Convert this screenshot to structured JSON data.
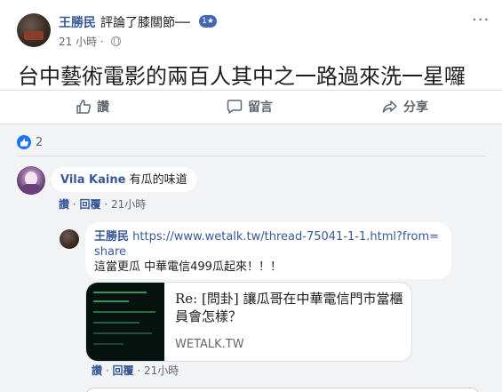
{
  "post": {
    "author": "王勝民",
    "action": "評論了膝關節──",
    "share_badge": "1★",
    "time": "21 小時",
    "separator": "·",
    "text": "台中藝術電影的兩百人其中之一路過來洗一星囉",
    "more": "···"
  },
  "actions": {
    "like": "讚",
    "comment": "留言",
    "share": "分享"
  },
  "reactions": {
    "count": "2"
  },
  "comments": [
    {
      "author": "Vila Kaine",
      "text": "有瓜的味道",
      "like": "讚",
      "reply": "回覆",
      "time": "21小時"
    }
  ],
  "reply": {
    "author": "王勝民",
    "link": "https://www.wetalk.tw/thread-75041-1-1.html?from=share",
    "text": "這當更瓜 中華電信499瓜起來！！！",
    "preview_title": "Re: [問卦] 讓瓜哥在中華電信門市當櫃員會怎樣？",
    "preview_domain": "WETALK.TW",
    "like": "讚",
    "reply": "回覆",
    "time": "21小時"
  },
  "colors": {
    "brand": "#385898",
    "like_blue": "#1877f2",
    "background_gray": "#f2f3f5"
  }
}
